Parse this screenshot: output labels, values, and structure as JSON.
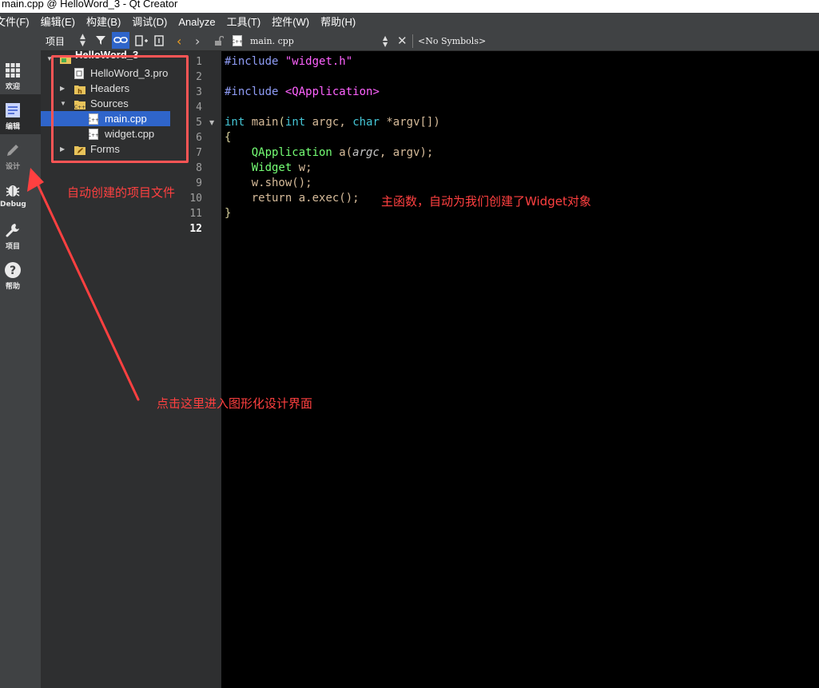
{
  "window": {
    "title": "main.cpp @ HelloWord_3 - Qt Creator"
  },
  "menubar": {
    "items": [
      {
        "label": "文件(F)"
      },
      {
        "label": "编辑(E)"
      },
      {
        "label": "构建(B)"
      },
      {
        "label": "调试(D)"
      },
      {
        "label": "Analyze"
      },
      {
        "label": "工具(T)"
      },
      {
        "label": "控件(W)"
      },
      {
        "label": "帮助(H)"
      }
    ]
  },
  "modes": [
    {
      "label": "欢迎",
      "icon": "grid-icon"
    },
    {
      "label": "编辑",
      "icon": "edit-document-icon"
    },
    {
      "label": "设计",
      "icon": "pencil-icon"
    },
    {
      "label": "Debug",
      "icon": "bug-icon"
    },
    {
      "label": "项目",
      "icon": "wrench-icon"
    },
    {
      "label": "帮助",
      "icon": "help-icon"
    }
  ],
  "navigator": {
    "view_label": "项目"
  },
  "editor_toolbar": {
    "file_name": "main. cpp",
    "symbols": "<No Symbols>"
  },
  "project_tree": {
    "root": "HelloWord_3",
    "items": [
      {
        "label": "HelloWord_3.pro"
      },
      {
        "label": "Headers"
      },
      {
        "label": "Sources"
      },
      {
        "label": "main.cpp"
      },
      {
        "label": "widget.cpp"
      },
      {
        "label": "Forms"
      }
    ]
  },
  "editor": {
    "line_numbers": [
      "1",
      "2",
      "3",
      "4",
      "5",
      "6",
      "7",
      "8",
      "9",
      "10",
      "11",
      "12"
    ],
    "code": {
      "l1_directive": "#include",
      "l1_file": "\"widget.h\"",
      "l3_directive": "#include",
      "l3_file": "<QApplication>",
      "l5_kw1": "int",
      "l5_fn": "main",
      "l5_p1": "(",
      "l5_kw2": "int",
      "l5_p2": " argc, ",
      "l5_kw3": "char",
      "l5_p3": " *argv[])",
      "l6": "{",
      "l7_cls": "QApplication",
      "l7_a": " a(",
      "l7_argc": "argc",
      "l7_b": ", argv);",
      "l8_cls": "Widget",
      "l8_rest": " w;",
      "l9": "w.show();",
      "l10_kw": "return",
      "l10_rest": " a.exec();",
      "l11": "}"
    }
  },
  "annotations": {
    "auto_files": "自动创建的项目文件",
    "main_func": "主函数，自动为我们创建了Widget对象",
    "design_hint": "点击这里进入图形化设计界面"
  },
  "colors": {
    "annotation": "#ff4040",
    "selection": "#2f65ca",
    "sidebar": "#404244"
  }
}
